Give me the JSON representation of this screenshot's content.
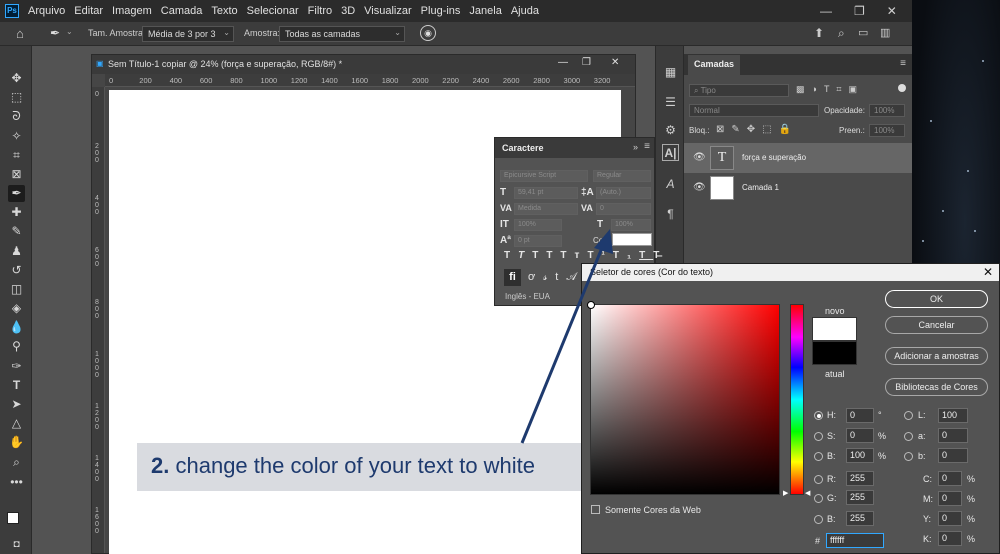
{
  "menubar": {
    "logo": "Ps",
    "items": [
      "Arquivo",
      "Editar",
      "Imagem",
      "Camada",
      "Texto",
      "Selecionar",
      "Filtro",
      "3D",
      "Visualizar",
      "Plug-ins",
      "Janela",
      "Ajuda"
    ],
    "window_buttons": [
      "—",
      "❐",
      "✕"
    ]
  },
  "options_bar": {
    "sample_size_label": "Tam. Amostra:",
    "sample_size_value": "Média de 3 por 3",
    "sample_label": "Amostra:",
    "sample_value": "Todas as camadas"
  },
  "document": {
    "title": "Sem Título-1 copiar @ 24% (força e superação, RGB/8#) *",
    "ruler_ticks": [
      "0",
      "200",
      "400",
      "600",
      "800",
      "1000",
      "1200",
      "1400",
      "1600",
      "1800",
      "2000",
      "2200",
      "2400",
      "2600",
      "2800",
      "3000",
      "3200"
    ],
    "vruler_labels": [
      "0",
      "200",
      "400",
      "600",
      "800",
      "1000",
      "1200",
      "1400",
      "1600"
    ]
  },
  "layers_panel": {
    "tab": "Camadas",
    "filter_placeholder": "Tipo",
    "blend_mode": "Normal",
    "opacity_label": "Opacidade:",
    "opacity_value": "100%",
    "lock_label": "Bloq.:",
    "fill_label": "Preen.:",
    "fill_value": "100%",
    "layers": [
      {
        "name": "força e superação",
        "kind": "text",
        "selected": true
      },
      {
        "name": "Camada 1",
        "kind": "pixel",
        "selected": false
      }
    ]
  },
  "character_panel": {
    "title": "Caractere",
    "font_family": "Epicursive Script",
    "font_style": "Regular",
    "font_size": "59,41 pt",
    "leading": "(Auto.)",
    "kerning": "Medida",
    "tracking": "0",
    "vscale": "100%",
    "hscale": "100%",
    "baseline": "0 pt",
    "color_label": "Cor:",
    "color_value": "#ffffff",
    "language": "Inglês - EUA"
  },
  "color_picker": {
    "title": "Seletor de cores (Cor do texto)",
    "new_label": "novo",
    "current_label": "atual",
    "new_color": "#ffffff",
    "current_color": "#000000",
    "ok": "OK",
    "cancel": "Cancelar",
    "add_swatches": "Adicionar a amostras",
    "libraries": "Bibliotecas de Cores",
    "web_only": "Somente Cores da Web",
    "h": "0",
    "h_unit": "°",
    "s": "0",
    "s_unit": "%",
    "b": "100",
    "b_unit": "%",
    "r": "255",
    "g": "255",
    "bl": "255",
    "l": "100",
    "a": "0",
    "lab_b": "0",
    "c": "0",
    "m": "0",
    "y": "0",
    "k": "0",
    "cmyk_unit": "%",
    "hex": "ffffff"
  },
  "callout": {
    "number": "2.",
    "text": "change the color of your text to white",
    "text_color": "#1e3a6e",
    "background": "#d9dbe0"
  }
}
